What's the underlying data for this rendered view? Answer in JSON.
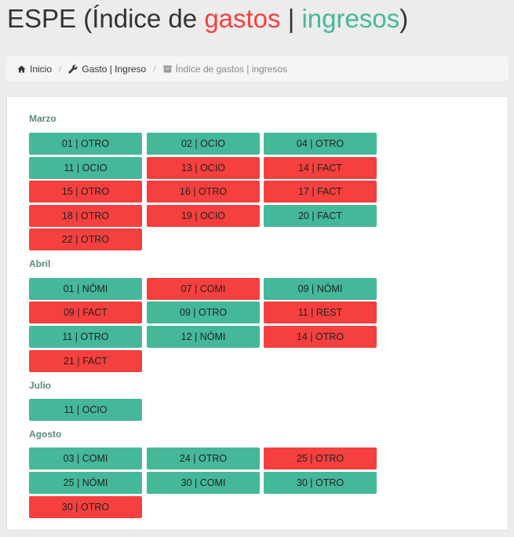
{
  "header": {
    "title_prefix": "ESPE (",
    "title_index": "Índice de ",
    "title_gastos": "gastos",
    "title_sep": " | ",
    "title_ingresos": "ingresos",
    "title_suffix": ")"
  },
  "breadcrumb": {
    "items": [
      {
        "label": "Inicio",
        "icon": "home-icon"
      },
      {
        "label": "Gasto | Ingreso",
        "icon": "wrench-icon"
      },
      {
        "label": "Índice de gastos | ingresos",
        "icon": "archive-icon"
      }
    ]
  },
  "colors": {
    "ingreso": "#45b89a",
    "gasto": "#f5403f"
  },
  "months": [
    {
      "name": "Marzo",
      "entries": [
        {
          "label": "01 | OTRO",
          "type": "ingreso"
        },
        {
          "label": "02 | OCIO",
          "type": "ingreso"
        },
        {
          "label": "04 | OTRO",
          "type": "ingreso"
        },
        {
          "label": "11 | OCIO",
          "type": "ingreso"
        },
        {
          "label": "13 | OCIO",
          "type": "gasto"
        },
        {
          "label": "14 | FACT",
          "type": "gasto"
        },
        {
          "label": "15 | OTRO",
          "type": "gasto"
        },
        {
          "label": "16 | OTRO",
          "type": "gasto"
        },
        {
          "label": "17 | FACT",
          "type": "gasto"
        },
        {
          "label": "18 | OTRO",
          "type": "gasto"
        },
        {
          "label": "19 | OCIO",
          "type": "gasto"
        },
        {
          "label": "20 | FACT",
          "type": "ingreso"
        },
        {
          "label": "22 | OTRO",
          "type": "gasto"
        }
      ]
    },
    {
      "name": "Abril",
      "entries": [
        {
          "label": "01 | NÓMI",
          "type": "ingreso"
        },
        {
          "label": "07 | COMI",
          "type": "gasto"
        },
        {
          "label": "09 | NÓMI",
          "type": "ingreso"
        },
        {
          "label": "09 | FACT",
          "type": "gasto"
        },
        {
          "label": "09 | OTRO",
          "type": "ingreso"
        },
        {
          "label": "11 | REST",
          "type": "gasto"
        },
        {
          "label": "11 | OTRO",
          "type": "ingreso"
        },
        {
          "label": "12 | NÓMI",
          "type": "ingreso"
        },
        {
          "label": "14 | OTRO",
          "type": "gasto"
        },
        {
          "label": "21 | FACT",
          "type": "gasto"
        }
      ]
    },
    {
      "name": "Julio",
      "entries": [
        {
          "label": "11 | OCIO",
          "type": "ingreso"
        }
      ]
    },
    {
      "name": "Agosto",
      "entries": [
        {
          "label": "03 | COMI",
          "type": "ingreso"
        },
        {
          "label": "24 | OTRO",
          "type": "ingreso"
        },
        {
          "label": "25 | OTRO",
          "type": "gasto"
        },
        {
          "label": "25 | NÓMI",
          "type": "ingreso"
        },
        {
          "label": "30 | COMI",
          "type": "ingreso"
        },
        {
          "label": "30 | OTRO",
          "type": "ingreso"
        },
        {
          "label": "30 | OTRO",
          "type": "gasto"
        }
      ]
    }
  ]
}
